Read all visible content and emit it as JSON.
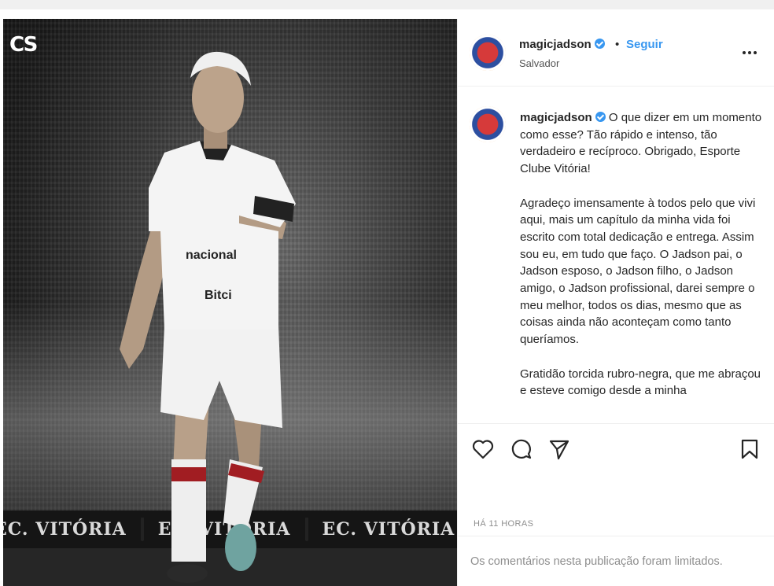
{
  "photo": {
    "logo_text": "CS",
    "banner_text": [
      "EC. VITÓRIA",
      "EC. VITÓRIA",
      "EC. VITÓRIA",
      "EC. VITÓRIA"
    ],
    "jersey_sponsors": [
      "nacional",
      "Bitci"
    ]
  },
  "header": {
    "username": "magicjadson",
    "dot": "•",
    "follow_label": "Seguir",
    "location": "Salvador",
    "more_icon": "more-horizontal-icon"
  },
  "caption": {
    "username": "magicjadson",
    "text": " O que dizer em um momento como esse? Tão rápido e intenso, tão verdadeiro e recíproco. Obrigado, Esporte Clube Vitória!\n\nAgradeço imensamente à todos pelo que vivi aqui, mais um capítulo da minha vida foi escrito com total dedicação e entrega. Assim sou eu, em tudo que faço. O Jadson pai, o Jadson esposo, o Jadson filho, o Jadson amigo, o Jadson profissional, darei sempre o meu melhor, todos os dias, mesmo que as coisas ainda não aconteçam como tanto queríamos.\n\nGratidão torcida rubro-negra, que me abraçou e esteve comigo desde a minha"
  },
  "actions": {
    "like_icon": "heart-icon",
    "comment_icon": "comment-icon",
    "share_icon": "send-icon",
    "save_icon": "bookmark-icon"
  },
  "timestamp": "HÁ 11 HORAS",
  "comments_notice": "Os comentários nesta publicação foram limitados."
}
